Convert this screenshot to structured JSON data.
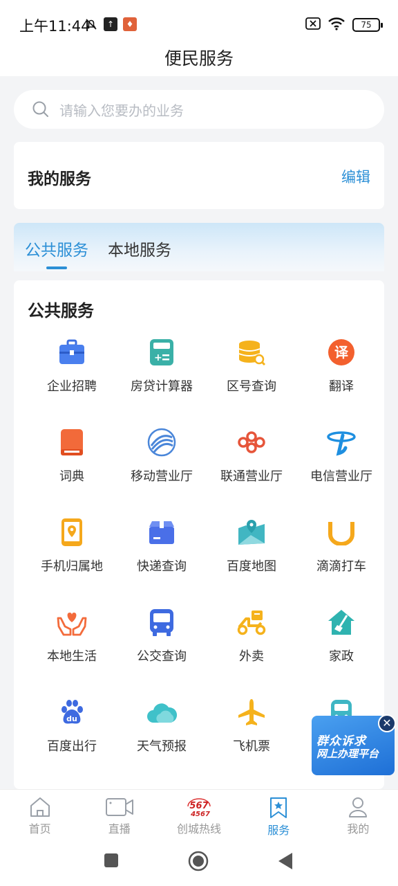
{
  "status_bar": {
    "time": "上午11:44",
    "battery": "75"
  },
  "header": {
    "title": "便民服务"
  },
  "search": {
    "placeholder": "请输入您要办的业务"
  },
  "my_services": {
    "title": "我的服务",
    "edit_label": "编辑"
  },
  "tabs": [
    {
      "label": "公共服务",
      "active": true
    },
    {
      "label": "本地服务",
      "active": false
    }
  ],
  "public_services": {
    "title": "公共服务",
    "items": [
      {
        "label": "企业招聘",
        "icon": "briefcase-icon"
      },
      {
        "label": "房贷计算器",
        "icon": "calculator-icon"
      },
      {
        "label": "区号查询",
        "icon": "coin-search-icon"
      },
      {
        "label": "翻译",
        "icon": "translate-icon"
      },
      {
        "label": "词典",
        "icon": "dictionary-icon"
      },
      {
        "label": "移动营业厅",
        "icon": "china-mobile-icon"
      },
      {
        "label": "联通营业厅",
        "icon": "china-unicom-icon"
      },
      {
        "label": "电信营业厅",
        "icon": "china-telecom-icon"
      },
      {
        "label": "手机归属地",
        "icon": "phone-location-icon"
      },
      {
        "label": "快递查询",
        "icon": "package-icon"
      },
      {
        "label": "百度地图",
        "icon": "map-icon"
      },
      {
        "label": "滴滴打车",
        "icon": "didi-icon"
      },
      {
        "label": "本地生活",
        "icon": "hands-heart-icon"
      },
      {
        "label": "公交查询",
        "icon": "bus-icon"
      },
      {
        "label": "外卖",
        "icon": "scooter-icon"
      },
      {
        "label": "家政",
        "icon": "house-clean-icon"
      },
      {
        "label": "百度出行",
        "icon": "baidu-paw-icon"
      },
      {
        "label": "天气预报",
        "icon": "cloud-icon"
      },
      {
        "label": "飞机票",
        "icon": "airplane-icon"
      },
      {
        "label": "",
        "icon": "train-icon"
      }
    ]
  },
  "floating_banner": {
    "line1": "群众诉求",
    "line2": "网上办理平台"
  },
  "bottom_nav": [
    {
      "label": "首页",
      "icon": "home-icon",
      "active": false
    },
    {
      "label": "直播",
      "icon": "video-icon",
      "active": false
    },
    {
      "label": "创城热线",
      "icon": "hotline-icon",
      "badge_top": "567",
      "badge_bottom": "4567",
      "active": false
    },
    {
      "label": "服务",
      "icon": "service-bookmark-icon",
      "active": true
    },
    {
      "label": "我的",
      "icon": "user-icon",
      "active": false
    }
  ],
  "colors": {
    "accent": "#2b8fd6",
    "background": "#f3f4f6"
  }
}
